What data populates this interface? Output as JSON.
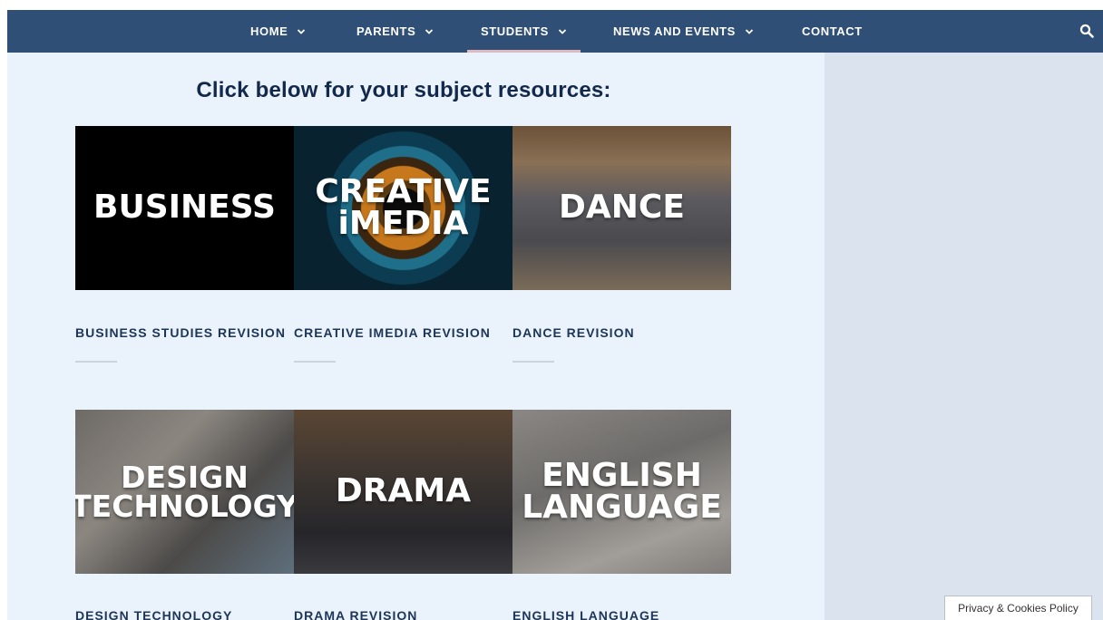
{
  "nav": {
    "items": [
      {
        "label": "HOME",
        "dropdown": true
      },
      {
        "label": "PARENTS",
        "dropdown": true
      },
      {
        "label": "STUDENTS",
        "dropdown": true,
        "active": true
      },
      {
        "label": "NEWS AND EVENTS",
        "dropdown": true
      },
      {
        "label": "CONTACT",
        "dropdown": false
      }
    ],
    "search_icon": "search-icon"
  },
  "heading": "Click below for your subject resources:",
  "subjects": [
    {
      "tile_text": "BUSINESS",
      "caption": "BUSINESS STUDIES REVISION"
    },
    {
      "tile_text": "CREATIVE\niMEDIA",
      "caption": "CREATIVE IMEDIA REVISION"
    },
    {
      "tile_text": "DANCE",
      "caption": "DANCE REVISION"
    },
    {
      "tile_text": "DESIGN\nTECHNOLOGY",
      "caption": "DESIGN TECHNOLOGY"
    },
    {
      "tile_text": "DRAMA",
      "caption": "DRAMA REVISION"
    },
    {
      "tile_text": "ENGLISH\nLANGUAGE",
      "caption": "ENGLISH LANGUAGE"
    }
  ],
  "privacy_link": "Privacy & Cookies Policy",
  "colors": {
    "nav_bg": "#2f4f77",
    "content_bg": "#eaf2fb",
    "sidebar_bg": "#dbe4ee",
    "heading": "#13294b",
    "active_underline": "#e0b8bf"
  }
}
